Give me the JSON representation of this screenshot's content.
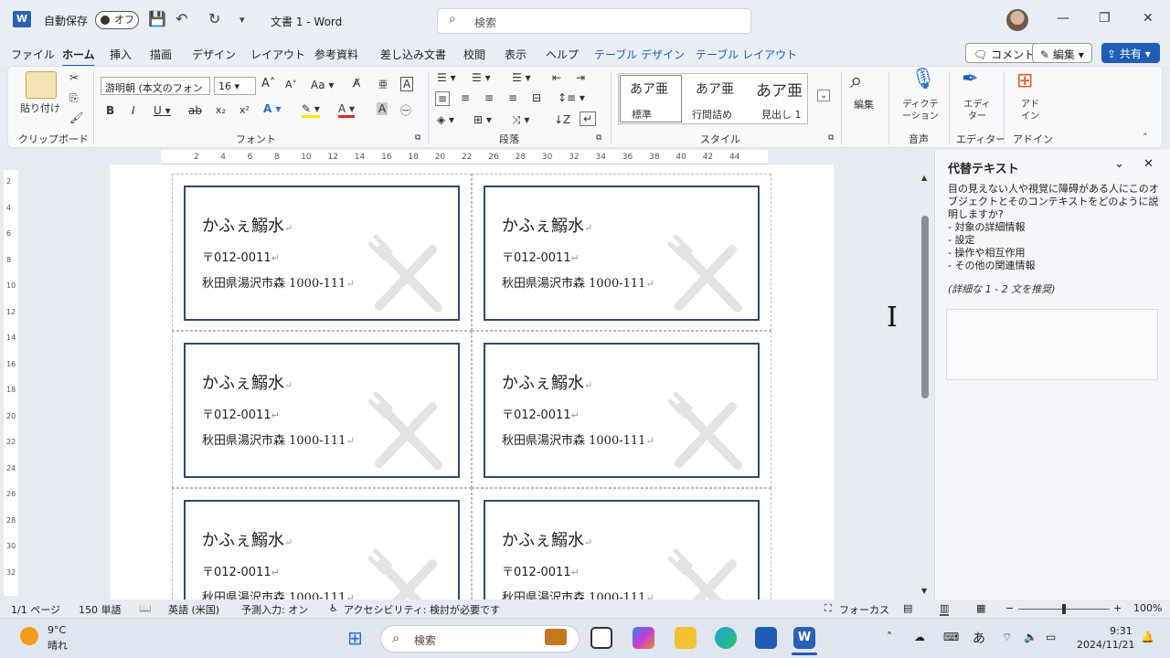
{
  "title_bar": {
    "autosave_label": "自動保存",
    "autosave_state": "オフ",
    "doc_title": "文書 1  -  Word",
    "search_placeholder": "検索"
  },
  "menu": [
    "ファイル",
    "ホーム",
    "挿入",
    "描画",
    "デザイン",
    "レイアウト",
    "参考資料",
    "差し込み文書",
    "校閲",
    "表示",
    "ヘルプ",
    "テーブル デザイン",
    "テーブル レイアウト"
  ],
  "top_buttons": {
    "comment": "コメント",
    "edit": "編集",
    "share": "共有"
  },
  "ribbon": {
    "paste": "貼り付け",
    "font_name": "游明朝 (本文のフォン",
    "font_size": "16",
    "aa_label": "Aa",
    "styles": [
      {
        "sample": "あア亜",
        "label": "標準"
      },
      {
        "sample": "あア亜",
        "label": "行間詰め"
      },
      {
        "sample": "あア亜",
        "label": "見出し 1"
      }
    ],
    "edit": "編集",
    "dictate": "ディクテーション",
    "editor": "エディター",
    "addin": "アドイン",
    "groups": {
      "clipboard": "クリップボード",
      "font": "フォント",
      "paragraph": "段落",
      "style": "スタイル",
      "voice": "音声",
      "editor": "エディター",
      "addin": "アドイン"
    }
  },
  "ruler_numbers": [
    "2",
    "4",
    "6",
    "8",
    "10",
    "12",
    "14",
    "16",
    "18",
    "20",
    "22",
    "26",
    "28",
    "30",
    "32",
    "34",
    "36",
    "38",
    "40",
    "42",
    "44"
  ],
  "vruler_numbers": [
    "2",
    "4",
    "6",
    "8",
    "10",
    "12",
    "14",
    "16",
    "18",
    "20",
    "22",
    "24",
    "26",
    "28",
    "30",
    "32"
  ],
  "label": {
    "name": "かふぇ鰯水",
    "zip": "〒012-0011",
    "address": "秋田県湯沢市森 1000-111"
  },
  "alt_pane": {
    "title": "代替テキスト",
    "body": "目の見えない人や視覚に障碍がある人にこのオブジェクトとそのコンテキストをどのように説明しますか?",
    "items": [
      "- 対象の詳細情報",
      "- 設定",
      "- 操作や相互作用",
      "- その他の関連情報"
    ],
    "hint": "(詳細な 1 - 2 文を推奨)"
  },
  "status": {
    "page": "1/1 ページ",
    "words": "150 単語",
    "lang": "英語 (米国)",
    "predict": "予測入力: オン",
    "access": "アクセシビリティ: 検討が必要です",
    "focus": "フォーカス",
    "zoom": "100%"
  },
  "taskbar": {
    "temp": "9°C",
    "weather": "晴れ",
    "search": "検索",
    "ime": "あ",
    "time": "9:31",
    "date": "2024/11/21"
  }
}
